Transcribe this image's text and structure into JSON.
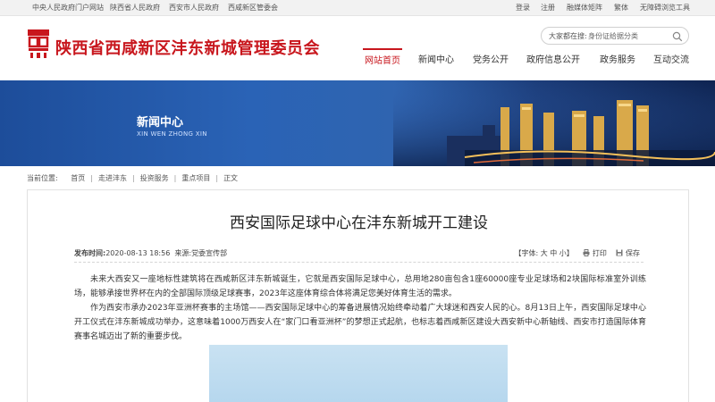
{
  "topbar": {
    "left_links": [
      "中央人民政府门户网站",
      "陕西省人民政府",
      "西安市人民政府",
      "西咸新区管委会"
    ],
    "right_links": [
      "登录",
      "注册",
      "融媒体矩阵",
      "繁体",
      "无障碍浏览工具"
    ]
  },
  "header": {
    "site_title": "陕西省西咸新区沣东新城管理委员会",
    "search_label": "大家都在搜:",
    "search_placeholder": "身份证给据分类"
  },
  "nav": {
    "items": [
      "网站首页",
      "新闻中心",
      "党务公开",
      "政府信息公开",
      "政务服务",
      "互动交流"
    ],
    "active_index": 0
  },
  "banner": {
    "title": "新闻中心",
    "subtitle": "XIN WEN ZHONG XIN"
  },
  "breadcrumb": {
    "label": "当前位置:",
    "items": [
      "首页",
      "走进沣东",
      "投资服务",
      "重点项目",
      "正文"
    ]
  },
  "article": {
    "title": "西安国际足球中心在沣东新城开工建设",
    "meta_date_label": "发布时间:",
    "meta_date": "2020-08-13 18:56",
    "meta_source_label": "来源:",
    "meta_source": "党委宣传部",
    "font_tool": "【字体: 大 中 小】",
    "print_label": "打印",
    "save_label": "保存",
    "paragraph_1": "未来大西安又一座地标性建筑将在西咸新区沣东新城诞生，它就是西安国际足球中心，总用地280亩包含1座60000座专业足球场和2块国际标准室外训练场，能够承接世界杯在内的全部国际顶级足球赛事，2023年这座体育综合体将满足您美好体育生活的需求。",
    "paragraph_2": "作为西安市承办2023年亚洲杯赛事的主场馆——西安国际足球中心的筹备进展情况始终牵动着广大球迷和西安人民的心。8月13日上午，西安国际足球中心开工仪式在沣东新城成功举办，这意味着1000万西安人在“家门口看亚洲杯”的梦想正式起航，也标志着西咸新区建设大西安新中心新轴线、西安市打造国际体育赛事名城迈出了新的重要步伐。"
  },
  "colors": {
    "brand_red": "#c8161d",
    "banner_blue": "#2a63b6"
  }
}
